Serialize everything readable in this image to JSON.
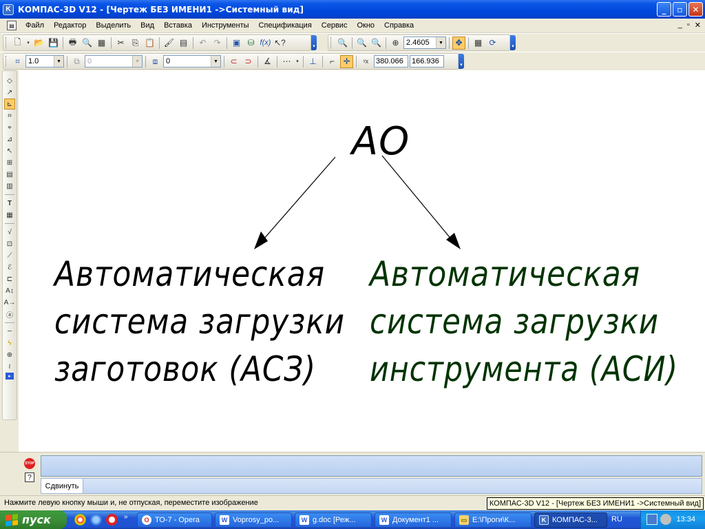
{
  "window": {
    "title": "КОМПАС-3D V12 - [Чертеж БЕЗ ИМЕНИ1 ->Системный вид]",
    "minimize": "_",
    "maximize": "▫",
    "close": "✕",
    "doc_controls": [
      "_",
      "▫",
      "✕"
    ]
  },
  "menu": [
    "Файл",
    "Редактор",
    "Выделить",
    "Вид",
    "Вставка",
    "Инструменты",
    "Спецификация",
    "Сервис",
    "Окно",
    "Справка"
  ],
  "toolbar": {
    "zoom_value": "2.4605",
    "line_style": "1.0",
    "layer_disabled": "0",
    "layer": "0",
    "coord_x": "380.066",
    "coord_y": "166.936"
  },
  "drawing": {
    "root": "АО",
    "left_lines": [
      "Автоматическая",
      "система загрузки",
      "заготовок (АСЗ)"
    ],
    "right_lines": [
      "Автоматическая",
      "система загрузки",
      "инструмента (АСИ)"
    ],
    "right_color": "#003300"
  },
  "property_panel": {
    "tab": "Сдвинуть"
  },
  "statusbar": {
    "message": "Нажмите левую кнопку мыши и, не отпуская, переместите изображение",
    "tooltip": "КОМПАС-3D V12 - [Чертеж БЕЗ ИМЕНИ1 ->Системный вид]"
  },
  "taskbar": {
    "start": "пуск",
    "tasks": [
      "ТО-7 - Opera",
      "Voprosy_po...",
      "g.doc [Реж...",
      "Документ1 ...",
      "E:\\Проги\\К...",
      "КОМПАС-3..."
    ],
    "language": "RU",
    "clock": "13:34"
  }
}
